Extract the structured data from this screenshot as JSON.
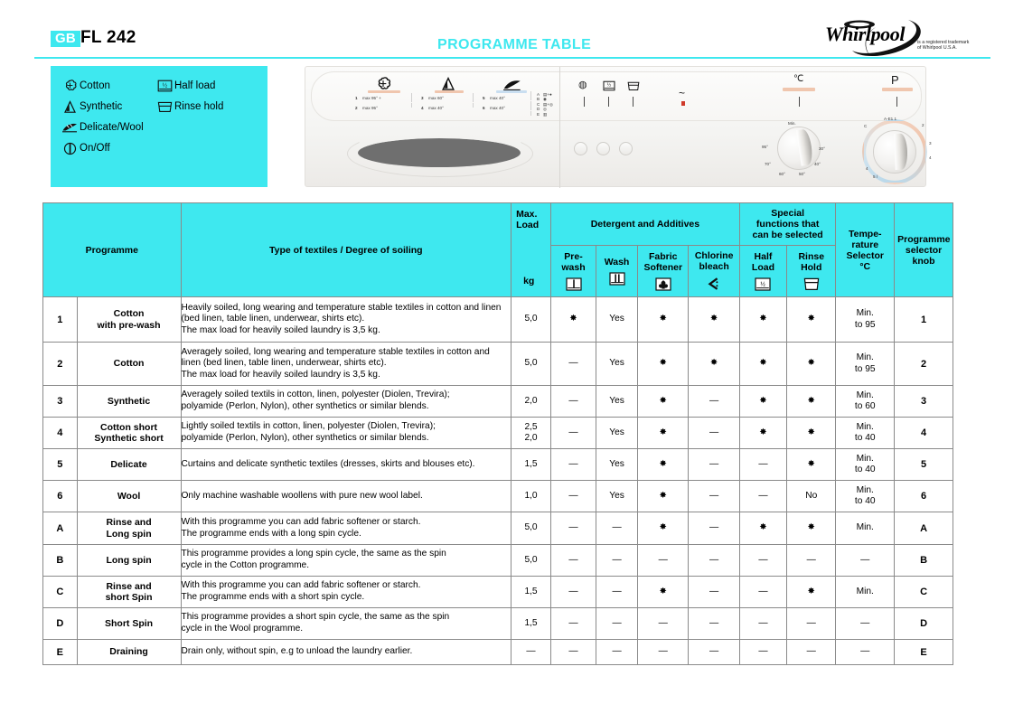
{
  "header": {
    "locale_badge": "GB",
    "model": "FL 242",
    "title": "PROGRAMME TABLE",
    "brand": "Whirlpool",
    "trademark_line1": "is a registered trademark",
    "trademark_line2": "of Whirlpool U.S.A."
  },
  "legend": {
    "column_a": [
      {
        "icon": "cotton-icon",
        "label": "Cotton"
      },
      {
        "icon": "synthetic-icon",
        "label": "Synthetic"
      },
      {
        "icon": "delicate-wool-icon",
        "label": "Delicate/Wool"
      },
      {
        "icon": "on-off-icon",
        "label": "On/Off"
      }
    ],
    "column_b": [
      {
        "icon": "half-load-icon",
        "label": "Half load"
      },
      {
        "icon": "rinse-hold-icon",
        "label": "Rinse hold"
      }
    ]
  },
  "machine_panel": {
    "left_group": {
      "programmes": [
        {
          "num": "1",
          "text": "max 95° +"
        },
        {
          "num": "2",
          "text": "max 95°"
        },
        {
          "num": "3",
          "text": "max 60°"
        },
        {
          "num": "4",
          "text": "max 40°"
        },
        {
          "num": "5",
          "text": "max 40°"
        },
        {
          "num": "6",
          "text": "max 40°"
        }
      ],
      "letters": [
        "A",
        "B",
        "C",
        "D",
        "E"
      ]
    },
    "right_group": {
      "icons": [
        "on-off-icon",
        "half-load-icon",
        "rinse-hold-icon"
      ],
      "mains_symbol": "~",
      "temp_knob_label": "°C",
      "programme_knob_label": "P",
      "temp_scale": [
        "Min.",
        "30°",
        "40°",
        "50°",
        "60°",
        "70°",
        "95°"
      ],
      "prog_scale": [
        "A",
        "B",
        "C",
        "D",
        "E",
        "1",
        "2",
        "3",
        "4",
        "5",
        "6"
      ]
    }
  },
  "table": {
    "headers": {
      "programme": "Programme",
      "type_of_textiles": "Type of textiles / Degree of soiling",
      "max_load": "Max.\nLoad",
      "max_load_unit": "kg",
      "detergent_group": "Detergent and Additives",
      "special_group": "Special\nfunctions that\ncan be selected",
      "temperature_selector": "Tempe-\nrature\nSelector\n°C",
      "programme_selector_knob": "Programme\nselector\nknob",
      "pre_wash": "Pre-\nwash",
      "wash": "Wash",
      "fabric_softener": "Fabric\nSoftener",
      "chlorine_bleach": "Chlorine\nbleach",
      "half_load": "Half\nLoad",
      "rinse_hold": "Rinse\nHold"
    },
    "rows": [
      {
        "num": "1",
        "programme": "Cotton\nwith pre-wash",
        "description": "Heavily soiled, long wearing and temperature stable textiles in cotton and linen (bed linen, table linen, underwear, shirts etc).\nThe max load for heavily soiled laundry is 3,5 kg.",
        "max_load": "5,0",
        "pre_wash": "✸",
        "wash": "Yes",
        "fabric_softener": "✸",
        "chlorine_bleach": "✸",
        "half_load": "✸",
        "rinse_hold": "✸",
        "temperature": "Min.\nto 95",
        "knob": "1"
      },
      {
        "num": "2",
        "programme": "Cotton",
        "description": "Averagely soiled, long wearing and temperature stable textiles in cotton and linen (bed linen, table linen, underwear, shirts etc).\nThe max load for heavily soiled laundry is 3,5 kg.",
        "max_load": "5,0",
        "pre_wash": "—",
        "wash": "Yes",
        "fabric_softener": "✸",
        "chlorine_bleach": "✸",
        "half_load": "✸",
        "rinse_hold": "✸",
        "temperature": "Min.\nto 95",
        "knob": "2"
      },
      {
        "num": "3",
        "programme": "Synthetic",
        "description": "Averagely soiled textils in cotton, linen, polyester (Diolen, Trevira);\npolyamide (Perlon, Nylon), other synthetics or similar blends.",
        "max_load": "2,0",
        "pre_wash": "—",
        "wash": "Yes",
        "fabric_softener": "✸",
        "chlorine_bleach": "—",
        "half_load": "✸",
        "rinse_hold": "✸",
        "temperature": "Min.\nto 60",
        "knob": "3"
      },
      {
        "num": "4",
        "programme": "Cotton short\nSynthetic short",
        "description": "Lightly soiled textils in cotton, linen, polyester (Diolen, Trevira);\npolyamide (Perlon, Nylon), other synthetics or similar blends.",
        "max_load": "2,5\n2,0",
        "pre_wash": "—",
        "wash": "Yes",
        "fabric_softener": "✸",
        "chlorine_bleach": "—",
        "half_load": "✸",
        "rinse_hold": "✸",
        "temperature": "Min.\nto 40",
        "knob": "4"
      },
      {
        "num": "5",
        "programme": "Delicate",
        "description": "Curtains and delicate synthetic textiles (dresses, skirts and blouses etc).",
        "max_load": "1,5",
        "pre_wash": "—",
        "wash": "Yes",
        "fabric_softener": "✸",
        "chlorine_bleach": "—",
        "half_load": "—",
        "rinse_hold": "✸",
        "temperature": "Min.\nto 40",
        "knob": "5"
      },
      {
        "num": "6",
        "programme": "Wool",
        "description": "Only machine washable woollens with pure new wool label.",
        "max_load": "1,0",
        "pre_wash": "—",
        "wash": "Yes",
        "fabric_softener": "✸",
        "chlorine_bleach": "—",
        "half_load": "—",
        "rinse_hold": "No",
        "temperature": "Min.\nto 40",
        "knob": "6"
      },
      {
        "num": "A",
        "programme": "Rinse and\nLong spin",
        "description": "With this programme you can add fabric softener or starch.\nThe programme ends with a long spin cycle.",
        "max_load": "5,0",
        "pre_wash": "—",
        "wash": "—",
        "fabric_softener": "✸",
        "chlorine_bleach": "—",
        "half_load": "✸",
        "rinse_hold": "✸",
        "temperature": "Min.",
        "knob": "A"
      },
      {
        "num": "B",
        "programme": "Long spin",
        "description": "This programme provides a long spin cycle, the same as the spin\ncycle in the Cotton programme.",
        "max_load": "5,0",
        "pre_wash": "—",
        "wash": "—",
        "fabric_softener": "—",
        "chlorine_bleach": "—",
        "half_load": "—",
        "rinse_hold": "—",
        "temperature": "—",
        "knob": "B"
      },
      {
        "num": "C",
        "programme": "Rinse and\nshort Spin",
        "description": "With this programme you can add fabric softener or starch.\nThe programme ends with a short spin cycle.",
        "max_load": "1,5",
        "pre_wash": "—",
        "wash": "—",
        "fabric_softener": "✸",
        "chlorine_bleach": "—",
        "half_load": "—",
        "rinse_hold": "✸",
        "temperature": "Min.",
        "knob": "C"
      },
      {
        "num": "D",
        "programme": "Short Spin",
        "description": "This programme provides a short spin cycle, the same as the spin\ncycle in the Wool programme.",
        "max_load": "1,5",
        "pre_wash": "—",
        "wash": "—",
        "fabric_softener": "—",
        "chlorine_bleach": "—",
        "half_load": "—",
        "rinse_hold": "—",
        "temperature": "—",
        "knob": "D"
      },
      {
        "num": "E",
        "programme": "Draining",
        "description": "Drain only, without spin, e.g to unload the laundry earlier.",
        "max_load": "—",
        "pre_wash": "—",
        "wash": "—",
        "fabric_softener": "—",
        "chlorine_bleach": "—",
        "half_load": "—",
        "rinse_hold": "—",
        "temperature": "—",
        "knob": "E"
      }
    ]
  },
  "colors": {
    "accent_cyan": "#3ee8ef",
    "border_gray": "#8a8a8a",
    "text_black": "#000000"
  }
}
